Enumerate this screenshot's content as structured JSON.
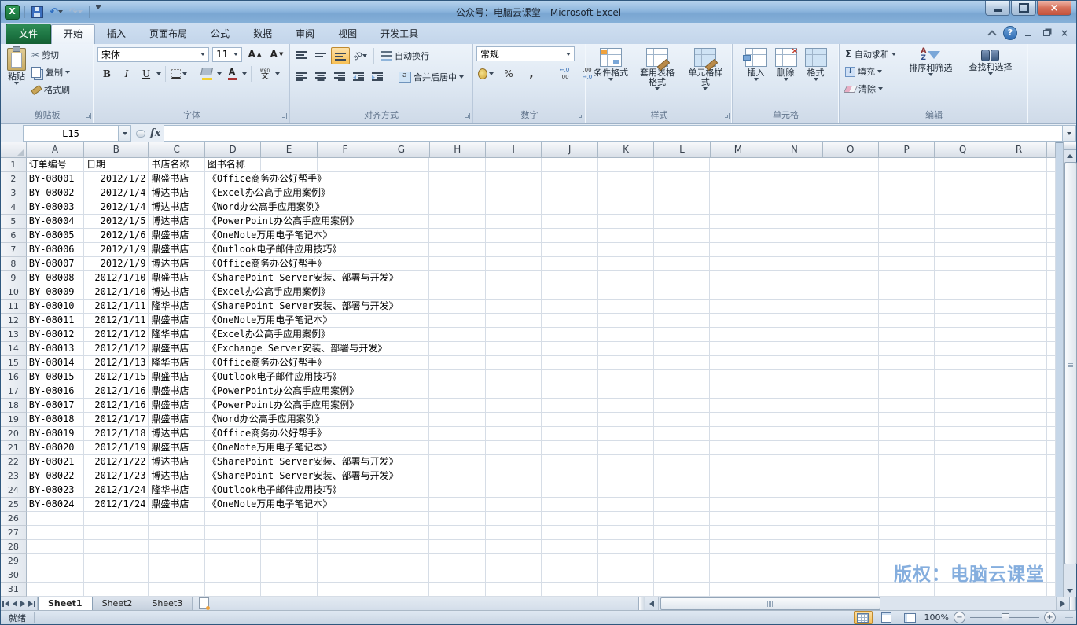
{
  "window": {
    "title": "公众号：电脑云课堂 - Microsoft Excel"
  },
  "ribbon": {
    "tabs": [
      {
        "label": "文件"
      },
      {
        "label": "开始"
      },
      {
        "label": "插入"
      },
      {
        "label": "页面布局"
      },
      {
        "label": "公式"
      },
      {
        "label": "数据"
      },
      {
        "label": "审阅"
      },
      {
        "label": "视图"
      },
      {
        "label": "开发工具"
      }
    ],
    "active_tab": "开始",
    "groups": {
      "clipboard": {
        "label": "剪贴板",
        "paste": "粘贴",
        "cut": "剪切",
        "copy": "复制",
        "format_painter": "格式刷"
      },
      "font": {
        "label": "字体",
        "font_name": "宋体",
        "font_size": "11"
      },
      "alignment": {
        "label": "对齐方式",
        "wrap": "自动换行",
        "merge": "合并后居中"
      },
      "number": {
        "label": "数字",
        "format": "常规"
      },
      "styles": {
        "label": "样式",
        "conditional": "条件格式",
        "table": "套用表格格式",
        "cell_styles": "单元格样式"
      },
      "cells": {
        "label": "单元格",
        "insert": "插入",
        "delete": "删除",
        "format": "格式"
      },
      "editing": {
        "label": "编辑",
        "autosum": "自动求和",
        "fill": "填充",
        "clear": "清除",
        "sort": "排序和筛选",
        "find": "查找和选择"
      }
    }
  },
  "formula_bar": {
    "name_box": "L15",
    "formula": ""
  },
  "sheet": {
    "columns": [
      "A",
      "B",
      "C",
      "D",
      "E",
      "F",
      "G",
      "H",
      "I",
      "J",
      "K",
      "L",
      "M",
      "N",
      "O",
      "P",
      "Q",
      "R"
    ],
    "visible_rows": 31,
    "header_row": [
      "订单编号",
      "日期",
      "书店名称",
      "图书名称"
    ],
    "records": [
      {
        "row": 2,
        "order": "BY-08001",
        "date": "2012/1/2",
        "store": "鼎盛书店",
        "book": "《Office商务办公好帮手》"
      },
      {
        "row": 3,
        "order": "BY-08002",
        "date": "2012/1/4",
        "store": "博达书店",
        "book": "《Excel办公高手应用案例》"
      },
      {
        "row": 4,
        "order": "BY-08003",
        "date": "2012/1/4",
        "store": "博达书店",
        "book": "《Word办公高手应用案例》"
      },
      {
        "row": 5,
        "order": "BY-08004",
        "date": "2012/1/5",
        "store": "博达书店",
        "book": "《PowerPoint办公高手应用案例》"
      },
      {
        "row": 6,
        "order": "BY-08005",
        "date": "2012/1/6",
        "store": "鼎盛书店",
        "book": "《OneNote万用电子笔记本》"
      },
      {
        "row": 7,
        "order": "BY-08006",
        "date": "2012/1/9",
        "store": "鼎盛书店",
        "book": "《Outlook电子邮件应用技巧》"
      },
      {
        "row": 8,
        "order": "BY-08007",
        "date": "2012/1/9",
        "store": "博达书店",
        "book": "《Office商务办公好帮手》"
      },
      {
        "row": 9,
        "order": "BY-08008",
        "date": "2012/1/10",
        "store": "鼎盛书店",
        "book": "《SharePoint Server安装、部署与开发》"
      },
      {
        "row": 10,
        "order": "BY-08009",
        "date": "2012/1/10",
        "store": "博达书店",
        "book": "《Excel办公高手应用案例》"
      },
      {
        "row": 11,
        "order": "BY-08010",
        "date": "2012/1/11",
        "store": "隆华书店",
        "book": "《SharePoint Server安装、部署与开发》"
      },
      {
        "row": 12,
        "order": "BY-08011",
        "date": "2012/1/11",
        "store": "鼎盛书店",
        "book": "《OneNote万用电子笔记本》"
      },
      {
        "row": 13,
        "order": "BY-08012",
        "date": "2012/1/12",
        "store": "隆华书店",
        "book": "《Excel办公高手应用案例》"
      },
      {
        "row": 14,
        "order": "BY-08013",
        "date": "2012/1/12",
        "store": "鼎盛书店",
        "book": "《Exchange Server安装、部署与开发》"
      },
      {
        "row": 15,
        "order": "BY-08014",
        "date": "2012/1/13",
        "store": "隆华书店",
        "book": "《Office商务办公好帮手》"
      },
      {
        "row": 16,
        "order": "BY-08015",
        "date": "2012/1/15",
        "store": "鼎盛书店",
        "book": "《Outlook电子邮件应用技巧》"
      },
      {
        "row": 17,
        "order": "BY-08016",
        "date": "2012/1/16",
        "store": "鼎盛书店",
        "book": "《PowerPoint办公高手应用案例》"
      },
      {
        "row": 18,
        "order": "BY-08017",
        "date": "2012/1/16",
        "store": "鼎盛书店",
        "book": "《PowerPoint办公高手应用案例》"
      },
      {
        "row": 19,
        "order": "BY-08018",
        "date": "2012/1/17",
        "store": "鼎盛书店",
        "book": "《Word办公高手应用案例》"
      },
      {
        "row": 20,
        "order": "BY-08019",
        "date": "2012/1/18",
        "store": "博达书店",
        "book": "《Office商务办公好帮手》"
      },
      {
        "row": 21,
        "order": "BY-08020",
        "date": "2012/1/19",
        "store": "鼎盛书店",
        "book": "《OneNote万用电子笔记本》"
      },
      {
        "row": 22,
        "order": "BY-08021",
        "date": "2012/1/22",
        "store": "博达书店",
        "book": "《SharePoint Server安装、部署与开发》"
      },
      {
        "row": 23,
        "order": "BY-08022",
        "date": "2012/1/23",
        "store": "博达书店",
        "book": "《SharePoint Server安装、部署与开发》"
      },
      {
        "row": 24,
        "order": "BY-08023",
        "date": "2012/1/24",
        "store": "隆华书店",
        "book": "《Outlook电子邮件应用技巧》"
      },
      {
        "row": 25,
        "order": "BY-08024",
        "date": "2012/1/24",
        "store": "鼎盛书店",
        "book": "《OneNote万用电子笔记本》"
      }
    ]
  },
  "sheet_tabs": {
    "tabs": [
      "Sheet1",
      "Sheet2",
      "Sheet3"
    ],
    "active": "Sheet1"
  },
  "status_bar": {
    "mode": "就绪",
    "zoom": "100%"
  },
  "watermark": {
    "text": "版权：电脑云课堂",
    "color": "#85aede"
  }
}
